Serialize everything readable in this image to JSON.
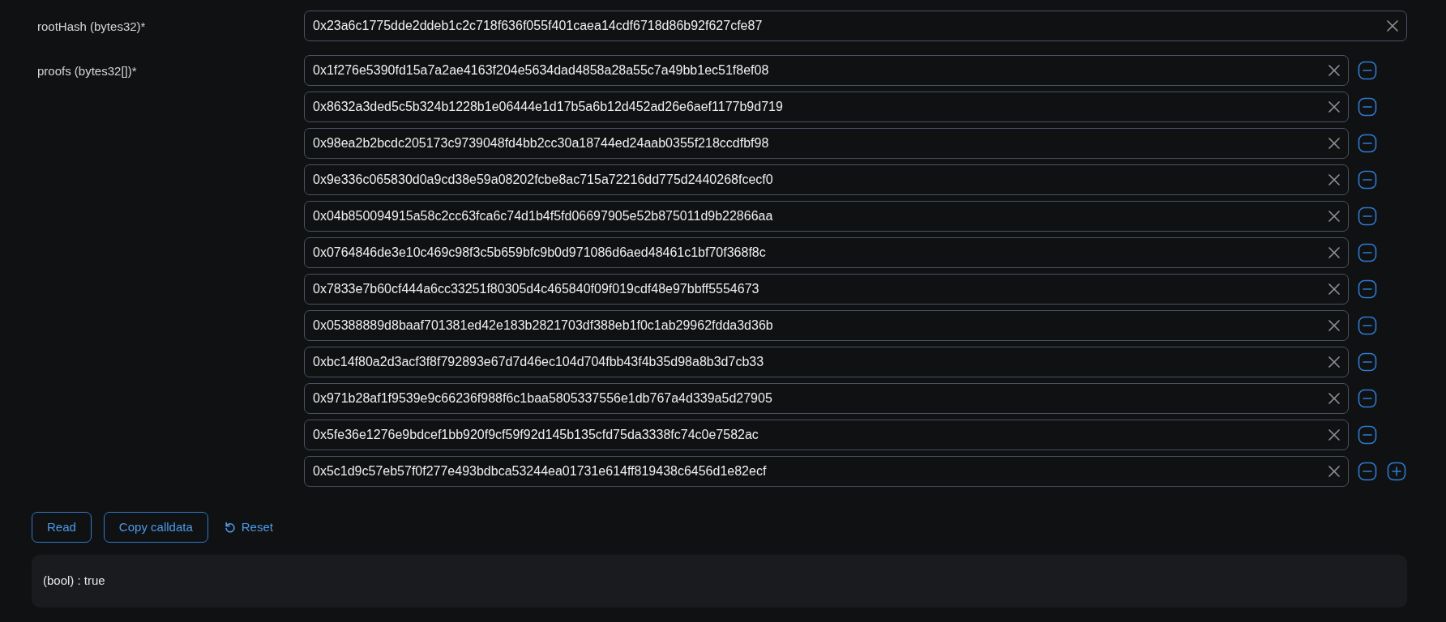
{
  "fields": [
    {
      "label": "rootHash (bytes32)*",
      "kind": "single",
      "values": [
        "0x23a6c1775dde2ddeb1c2c718f636f055f401caea14cdf6718d86b92f627cfe87"
      ]
    },
    {
      "label": "proofs (bytes32[])*",
      "kind": "array",
      "values": [
        "0x1f276e5390fd15a7a2ae4163f204e5634dad4858a28a55c7a49bb1ec51f8ef08",
        "0x8632a3ded5c5b324b1228b1e06444e1d17b5a6b12d452ad26e6aef1177b9d719",
        "0x98ea2b2bcdc205173c9739048fd4bb2cc30a18744ed24aab0355f218ccdfbf98",
        "0x9e336c065830d0a9cd38e59a08202fcbe8ac715a72216dd775d2440268fcecf0",
        "0x04b850094915a58c2cc63fca6c74d1b4f5fd06697905e52b875011d9b22866aa",
        "0x0764846de3e10c469c98f3c5b659bfc9b0d971086d6aed48461c1bf70f368f8c",
        "0x7833e7b60cf444a6cc33251f80305d4c465840f09f019cdf48e97bbff5554673",
        "0x05388889d8baaf701381ed42e183b2821703df388eb1f0c1ab29962fdda3d36b",
        "0xbc14f80a2d3acf3f8f792893e67d7d46ec104d704fbb43f4b35d98a8b3d7cb33",
        "0x971b28af1f9539e9c66236f988f6c1baa5805337556e1db767a4d339a5d27905",
        "0x5fe36e1276e9bdcef1bb920f9cf59f92d145b135cfd75da3338fc74c0e7582ac",
        "0x5c1d9c57eb57f0f277e493bdbca53244ea01731e614ff819438c6456d1e82ecf"
      ]
    }
  ],
  "buttons": [
    {
      "label": "Read",
      "kind": "outline"
    },
    {
      "label": "Copy calldata",
      "kind": "outline"
    },
    {
      "label": "Reset",
      "kind": "link"
    }
  ],
  "result": "(bool) : true"
}
